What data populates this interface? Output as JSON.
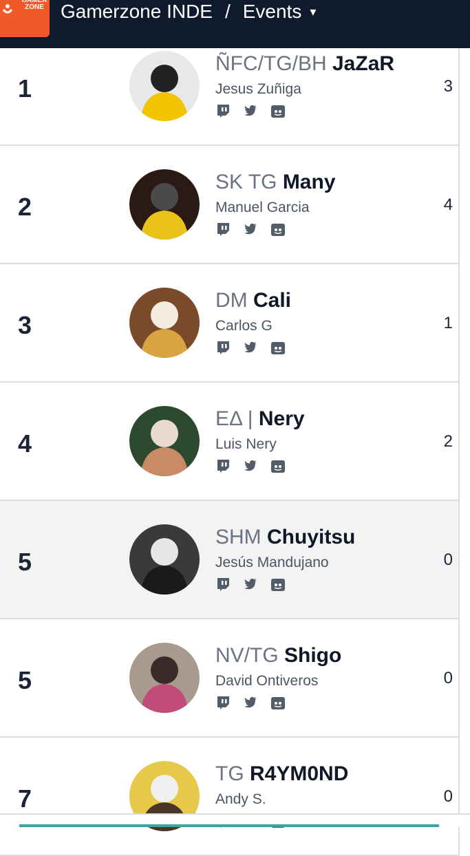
{
  "header": {
    "logo_text": "GAMER ZONE",
    "org": "Gamerzone INDE",
    "separator": "/",
    "section": "Events",
    "caret": "▾"
  },
  "colors": {
    "header_bg": "#0f1b2d",
    "logo_bg": "#f05a28",
    "highlight_row": "#f3f3f3",
    "prefix": "#6b7280"
  },
  "icons": {
    "social": [
      "twitch-icon",
      "twitter-icon",
      "discord-icon"
    ],
    "header": "chevron-down-icon"
  },
  "players": [
    {
      "rank": "1",
      "prefix": "ÑFC/TG/BH ",
      "gamertag": "JaZaR",
      "name": "Jesus Zuñiga",
      "score": "3",
      "highlight": false
    },
    {
      "rank": "2",
      "prefix": "SK TG ",
      "gamertag": "Many",
      "name": "Manuel Garcia",
      "score": "4",
      "highlight": false
    },
    {
      "rank": "3",
      "prefix": "DM ",
      "gamertag": "Cali",
      "name": "Carlos G",
      "score": "1",
      "highlight": false
    },
    {
      "rank": "4",
      "prefix": "EΔ | ",
      "gamertag": "Nery",
      "name": "Luis Nery",
      "score": "2",
      "highlight": false
    },
    {
      "rank": "5",
      "prefix": "SHM ",
      "gamertag": "Chuyitsu",
      "name": "Jesús Mandujano",
      "score": "0",
      "highlight": true
    },
    {
      "rank": "5",
      "prefix": "NV/TG ",
      "gamertag": "Shigo",
      "name": "David Ontiveros",
      "score": "0",
      "highlight": false
    },
    {
      "rank": "7",
      "prefix": "TG ",
      "gamertag": "R4YM0ND",
      "name": "Andy S.",
      "score": "0",
      "highlight": false
    }
  ]
}
